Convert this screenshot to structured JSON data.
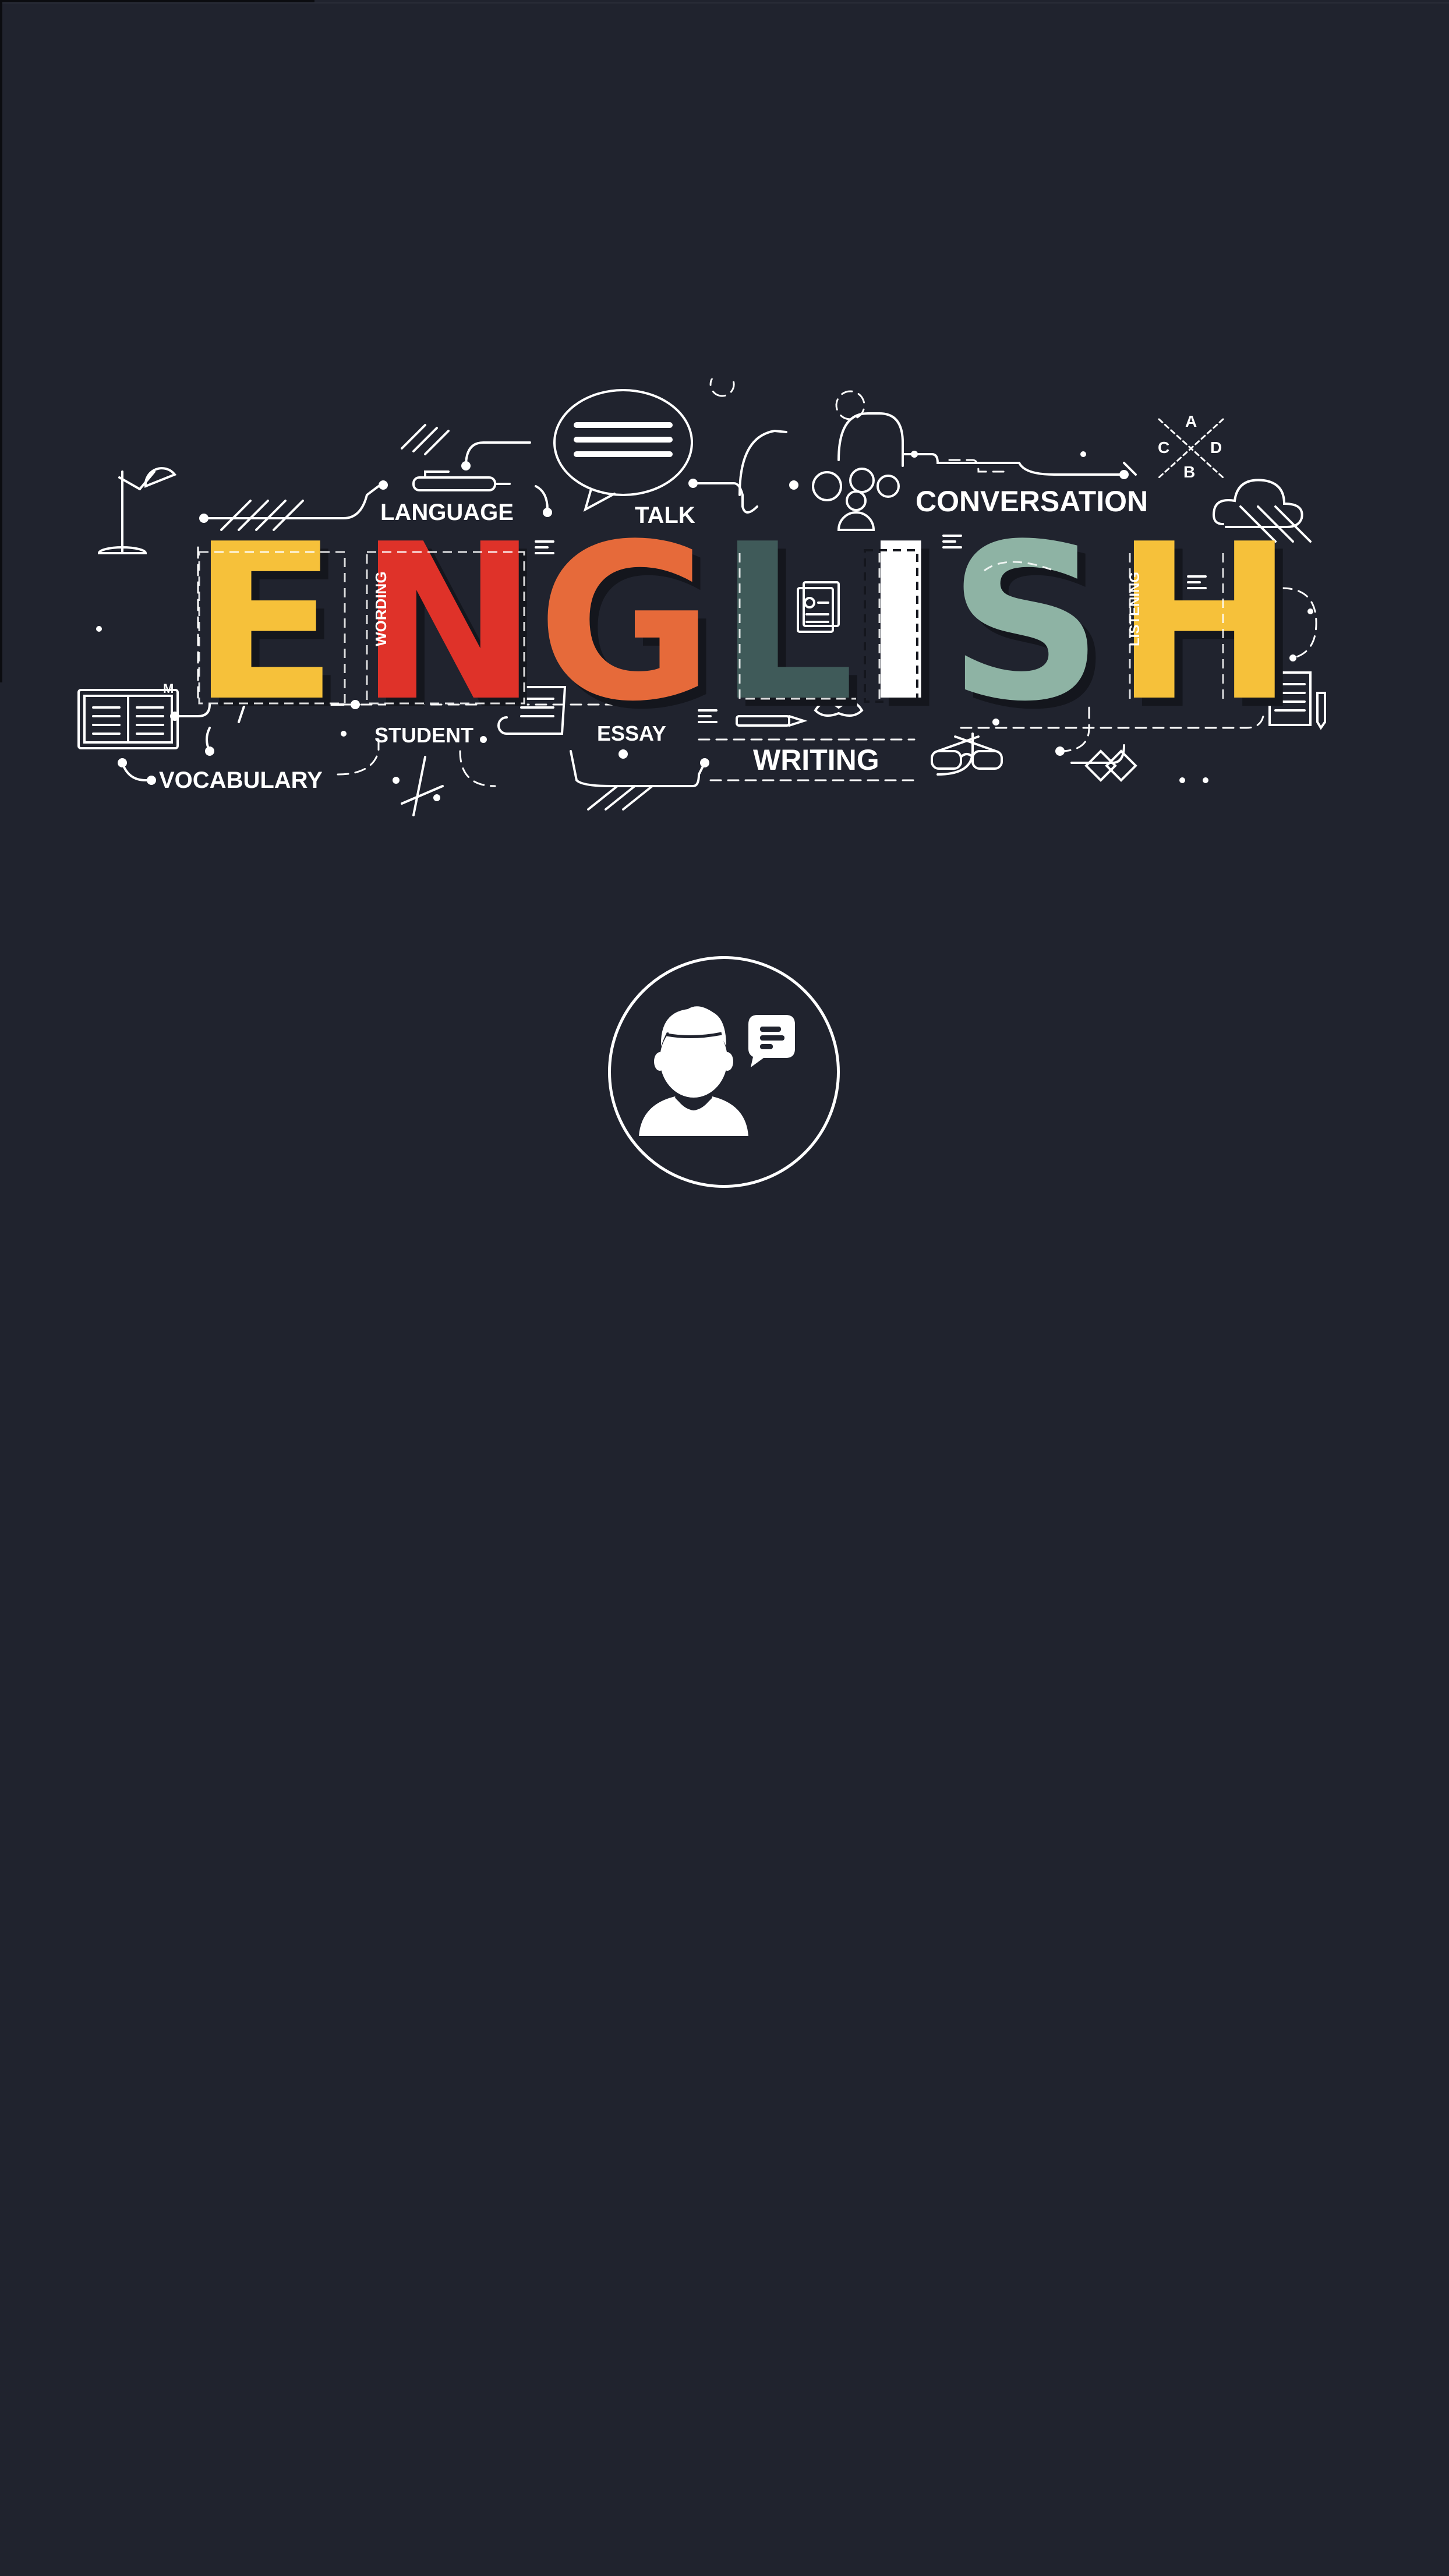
{
  "banner": {
    "word": "ENGLISH",
    "letters": [
      {
        "char": "E",
        "color": "#f6c13a"
      },
      {
        "char": "N",
        "color": "#df3229"
      },
      {
        "char": "G",
        "color": "#e66a3a"
      },
      {
        "char": "L",
        "color": "#3f5a59"
      },
      {
        "char": "I",
        "color": "#ffffff"
      },
      {
        "char": "S",
        "color": "#8eb3a4"
      },
      {
        "char": "H",
        "color": "#f6c13a"
      }
    ],
    "labels": {
      "language": "LANGUAGE",
      "talk": "TALK",
      "conversation": "CONVERSATION",
      "student": "STUDENT",
      "essay": "ESSAY",
      "writing": "WRITING",
      "vocabulary": "VOCABULARY",
      "wording": "WORDING",
      "listening": "LISTENING"
    },
    "quiz_letters": {
      "a": "A",
      "b": "B",
      "c": "C",
      "d": "D"
    },
    "small_m": "M"
  },
  "avatar": {
    "icon": "user-speech-bubble-icon",
    "accent": "#ffffff"
  },
  "colors": {
    "background": "#20232e",
    "line": "#ffffff"
  }
}
